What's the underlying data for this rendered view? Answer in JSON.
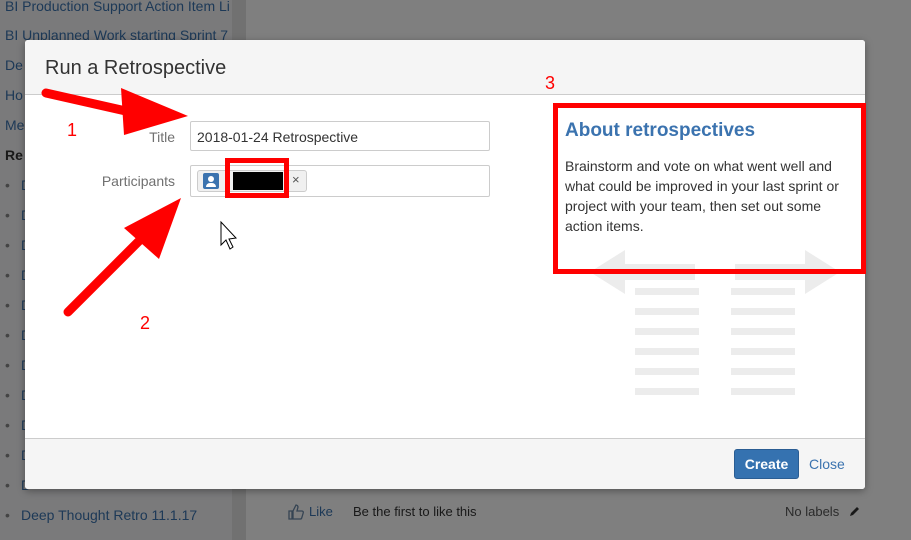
{
  "background": {
    "sidebar_links": [
      "BI Production Support Action Item Li",
      "BI Unplanned Work starting Sprint 7",
      "De",
      "Ho",
      "Me"
    ],
    "sidebar_section": "Re",
    "sidebar_children_initial": "D",
    "sidebar_last_child": "Deep Thought Retro 11.1.17",
    "footer": {
      "like_label": "Like",
      "like_prompt": "Be the first to like this",
      "labels_text": "No labels"
    }
  },
  "dialog": {
    "title": "Run a Retrospective",
    "form": {
      "title_label": "Title",
      "title_value": "2018-01-24 Retrospective",
      "participants_label": "Participants",
      "participant_remove": "×"
    },
    "about": {
      "heading": "About retrospectives",
      "text": "Brainstorm and vote on what went well and what could be improved in your last sprint or project with your team, then set out some action items."
    },
    "create_label": "Create",
    "close_label": "Close"
  },
  "annotations": [
    "1",
    "2",
    "3"
  ],
  "colors": {
    "accent": "#3572b0",
    "annotation": "#ff0000",
    "link": "#3b73af"
  },
  "icons": [
    "user-avatar-icon",
    "remove-icon",
    "thumbs-up-icon",
    "pencil-icon",
    "mouse-cursor-icon"
  ]
}
